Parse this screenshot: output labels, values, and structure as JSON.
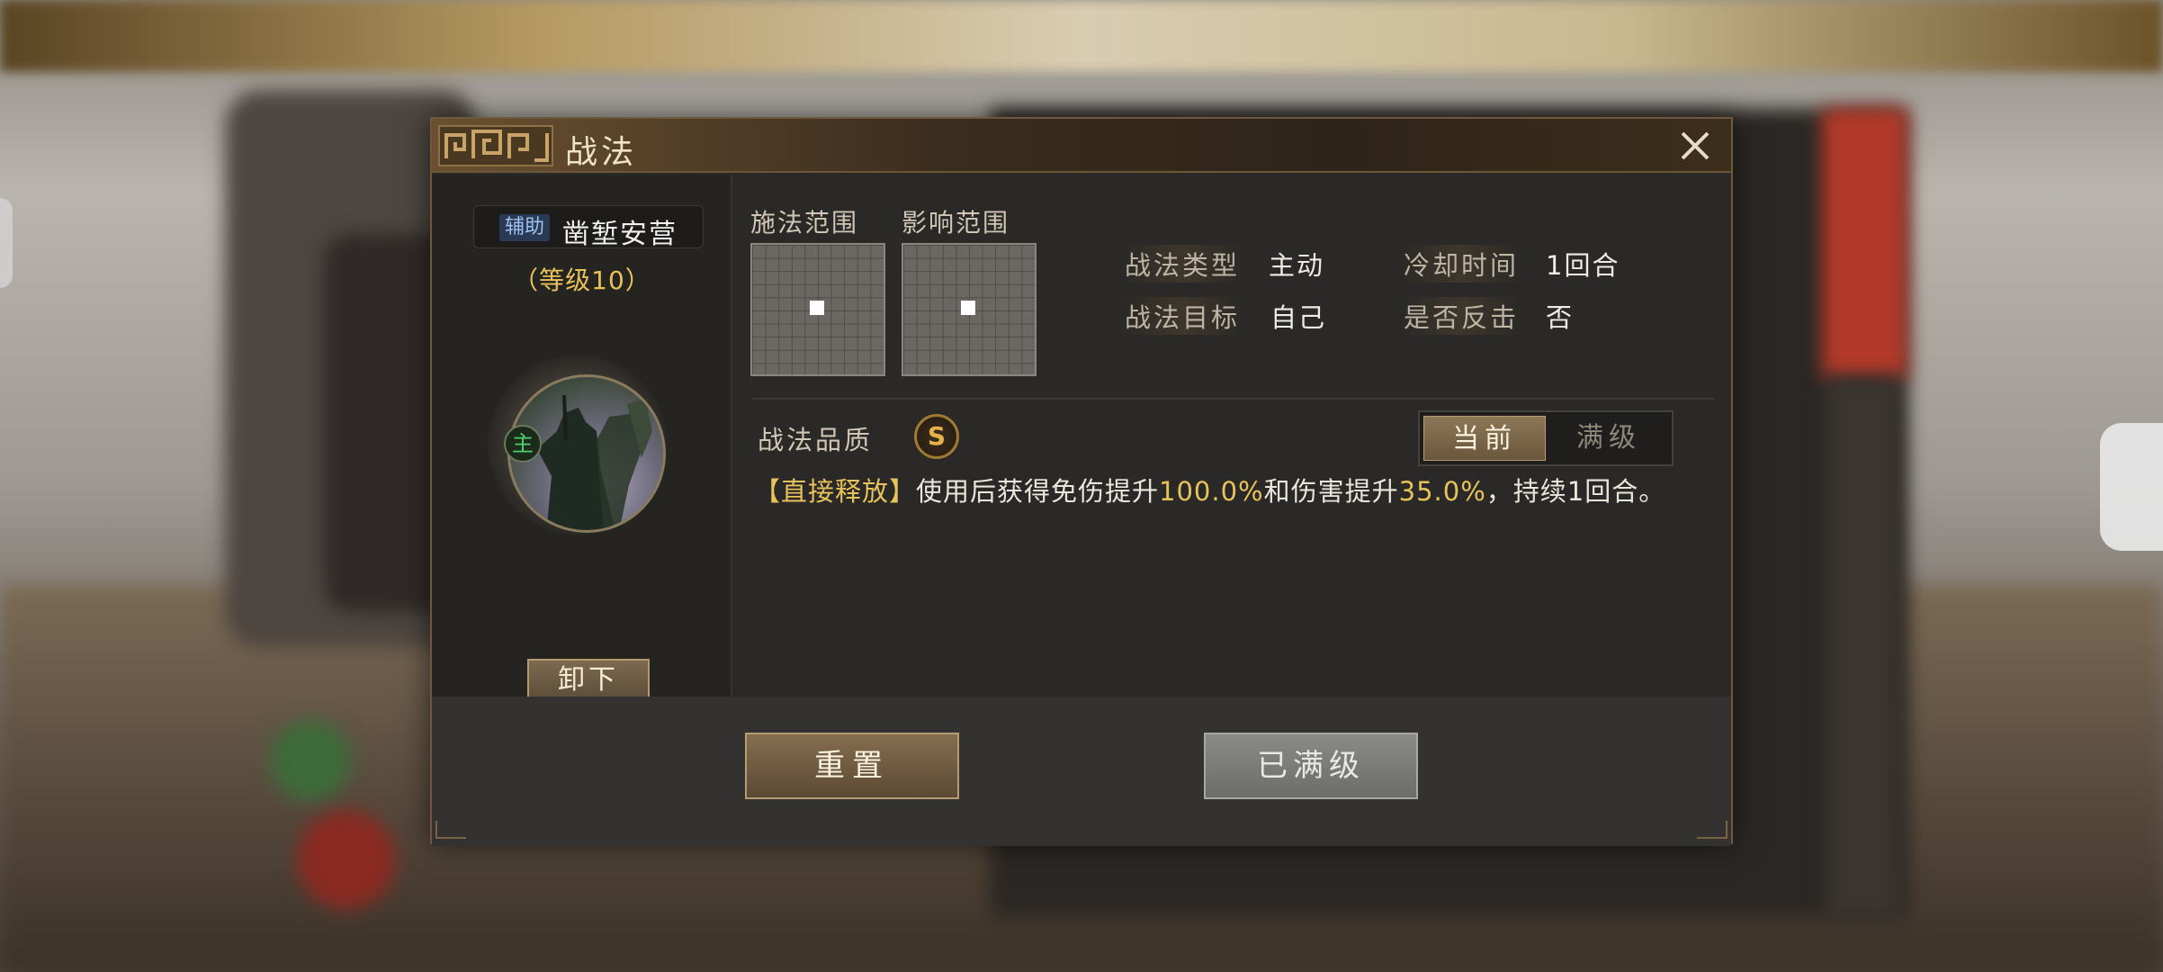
{
  "dialog": {
    "title": "战法",
    "close_icon": "close-icon"
  },
  "skill": {
    "role_badge": "辅助",
    "name": "凿堑安营",
    "level": "（等级10）",
    "main_badge": "主",
    "unequip_label": "卸下"
  },
  "ranges": {
    "cast_label": "施法范围",
    "effect_label": "影响范围"
  },
  "attributes": {
    "type_label": "战法类型",
    "type_value": "主动",
    "cooldown_label": "冷却时间",
    "cooldown_value": "1回合",
    "target_label": "战法目标",
    "target_value": "自己",
    "counter_label": "是否反击",
    "counter_value": "否"
  },
  "quality": {
    "label": "战法品质",
    "grade": "S"
  },
  "tabs": {
    "current": "当前",
    "max": "满级"
  },
  "description": {
    "prefix": "【直接释放】",
    "part1": "使用后获得免伤提升",
    "value1": "100.0%",
    "part2": "和伤害提升",
    "value2": "35.0%",
    "part3": "，持续1回合。"
  },
  "footer": {
    "reset_label": "重置",
    "maxed_label": "已满级"
  },
  "colors": {
    "accent_gold": "#e8c25a",
    "title_text": "#f1e3c8",
    "role_badge_bg": "#2a3a55"
  }
}
